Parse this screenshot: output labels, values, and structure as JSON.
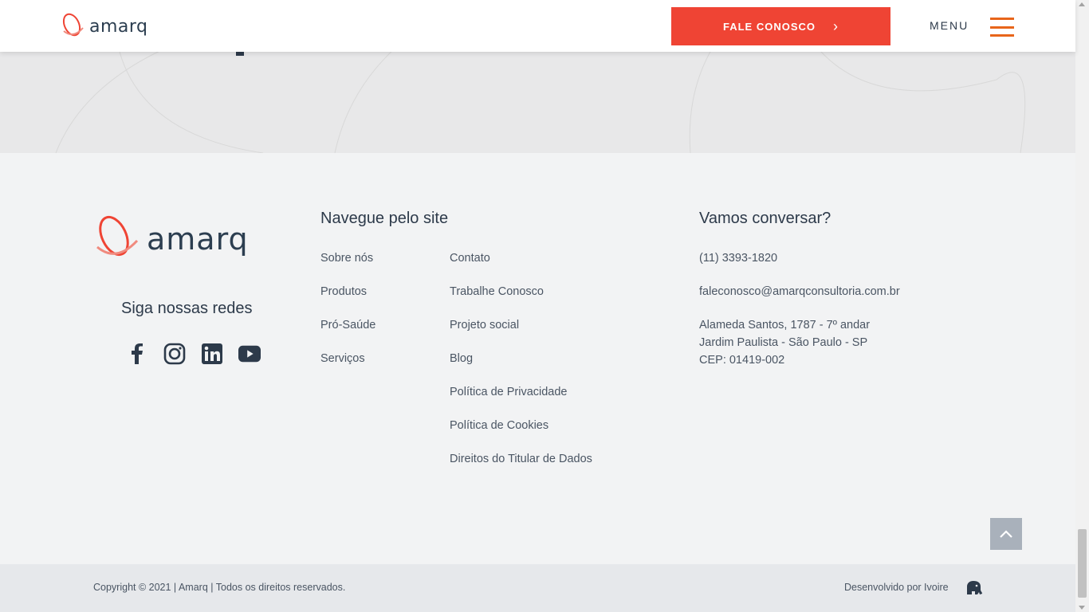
{
  "header": {
    "logo_text": "amarq",
    "cta_label": "FALE CONOSCO",
    "menu_label": "MENU"
  },
  "footer": {
    "logo_text": "amarq",
    "social_title": "Siga nossas redes",
    "socials": [
      "facebook-icon",
      "instagram-icon",
      "linkedin-icon",
      "youtube-icon"
    ],
    "nav_title": "Navegue pelo site",
    "nav_col1": [
      "Sobre nós",
      "Produtos",
      "Pró-Saúde",
      "Serviços"
    ],
    "nav_col2": [
      "Contato",
      "Trabalhe Conosco",
      "Projeto social",
      "Blog",
      "Política de Privacidade",
      "Política de Cookies",
      "Direitos do Titular de Dados"
    ],
    "contact_title": "Vamos conversar?",
    "phone": "(11) 3393-1820",
    "email": "faleconosco@amarqconsultoria.com.br",
    "address_line1": "Alameda Santos, 1787 - 7º andar",
    "address_line2": "Jardim Paulista - São Paulo - SP",
    "address_line3": "CEP: 01419-002"
  },
  "bottom": {
    "copyright": "Copyright © 2021 | Amarq | Todos os direitos reservados.",
    "developed_by": "Desenvolvido por Ivoire"
  },
  "colors": {
    "accent": "#ef4434",
    "menu_icon": "#e8651a",
    "text_dark": "#2d3a4a",
    "footer_bg": "#f2f3f4"
  }
}
